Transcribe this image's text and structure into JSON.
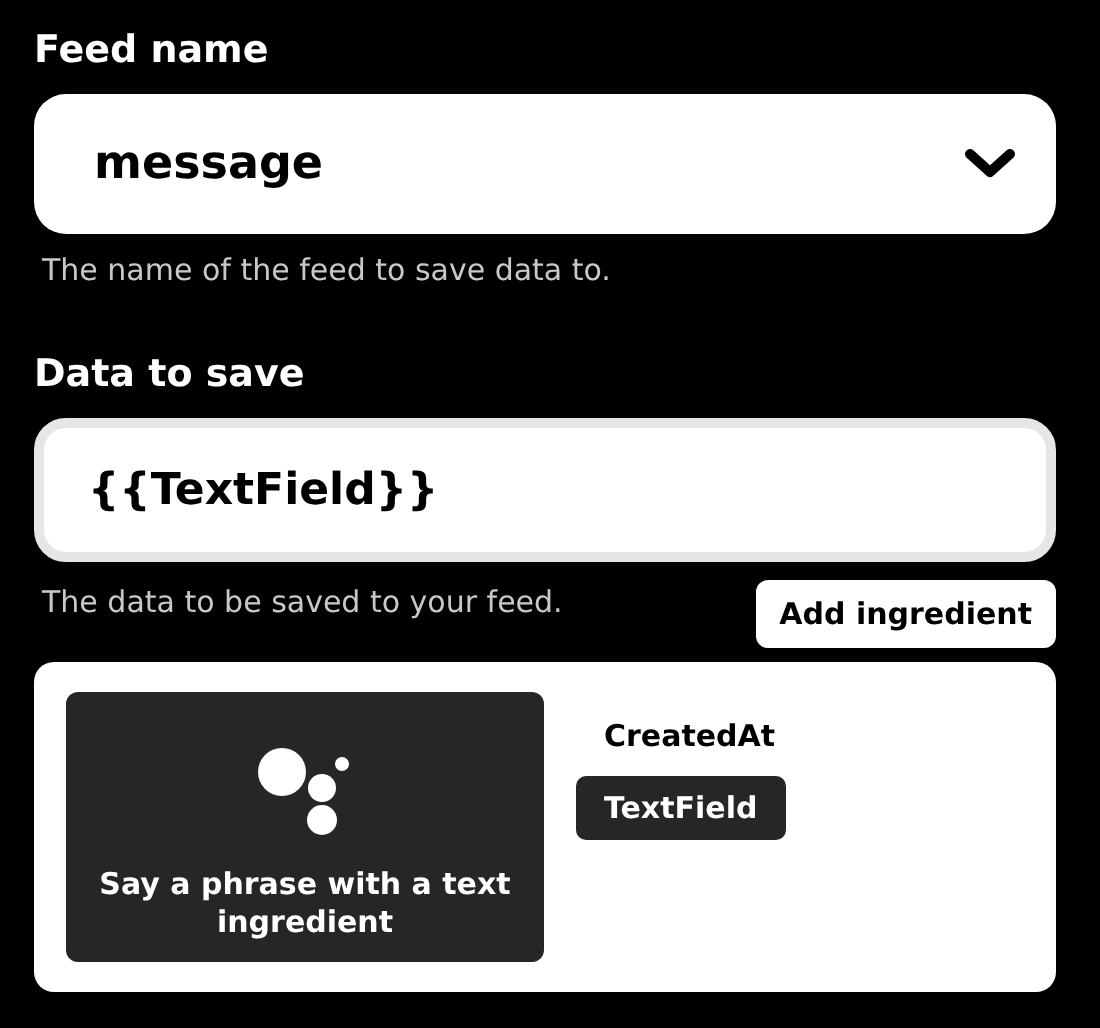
{
  "feed_name": {
    "label": "Feed name",
    "value": "message",
    "help": "The name of the feed to save data to."
  },
  "data_to_save": {
    "label": "Data to save",
    "value": "{{TextField}}",
    "help": "The data to be saved to your feed."
  },
  "add_ingredient_button": "Add ingredient",
  "ingredients_panel": {
    "trigger_card": "Say a phrase with a text ingredient",
    "ingredients": [
      {
        "label": "CreatedAt",
        "selected": false
      },
      {
        "label": "TextField",
        "selected": true
      }
    ]
  }
}
